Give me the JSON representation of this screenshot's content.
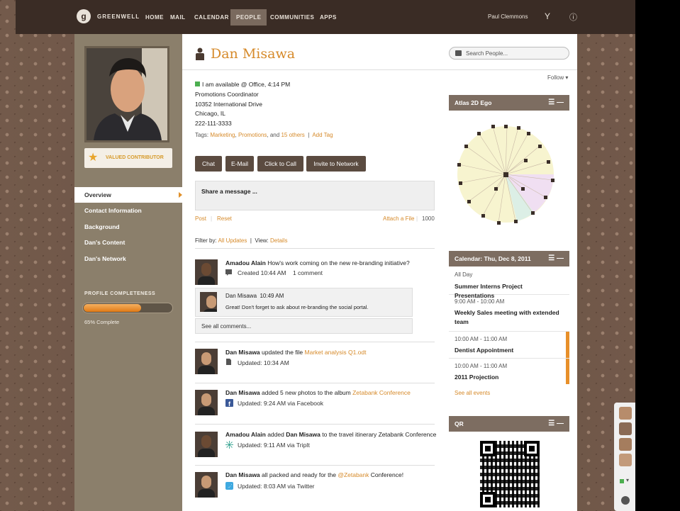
{
  "topbar": {
    "brand": "GREENWELL",
    "nav": [
      "HOME",
      "MAIL",
      "CALENDAR",
      "PEOPLE",
      "COMMUNITIES",
      "APPS"
    ],
    "active_nav": "PEOPLE",
    "user": "Paul Clemmons",
    "icons": [
      "filter-icon",
      "help-icon"
    ]
  },
  "sidebar": {
    "badge": "VALUED CONTRIBUTOR",
    "items": [
      "Overview",
      "Contact Information",
      "Background",
      "Dan's Content",
      "Dan's Network"
    ],
    "active_item": "Overview",
    "profile_completeness_label": "PROFILE COMPLETENESS",
    "profile_completeness_percent": 65,
    "profile_completeness_text": "65% Complete"
  },
  "profile": {
    "name": "Dan Misawa",
    "availability": "I am available @ Office, 4:14 PM",
    "title": "Promotions Coordinator",
    "address1": "10352 International Drive",
    "address2": "Chicago, IL",
    "phone": "222-111-3333",
    "tags_prefix": "Tags:",
    "tag1": "Marketing",
    "tag2": "Promotions",
    "tags_and": "and",
    "tags_others": "15 others",
    "add_tag": "Add Tag",
    "follow": "Follow",
    "search_placeholder": "Search People..."
  },
  "actions": [
    "Chat",
    "E-Mail",
    "Click to Call",
    "Invite to Network"
  ],
  "share": {
    "placeholder": "Share a message ...",
    "post": "Post",
    "reset": "Reset",
    "attach": "Attach a File",
    "count": "1000"
  },
  "filter": {
    "label": "Filter by:",
    "value": "All Updates",
    "view_label": "View:",
    "view_value": "Details"
  },
  "feed": [
    {
      "actor": "Amadou Alain",
      "text": "How's work coming on the new re-branding initiative?",
      "meta": "Created 10:44 AM",
      "extra": "1 comment"
    },
    {
      "actor": "Dan Misawa",
      "text": "updated the file",
      "link": "Market analysis Q1.odt",
      "meta": "Updated: 10:34 AM"
    },
    {
      "actor": "Dan Misawa",
      "text": "added 5 new photos to the album",
      "link": "Zetabank Conference",
      "meta": "Updated: 9:24 AM via Facebook"
    },
    {
      "actor": "Amadou Alain",
      "text": "added",
      "target": "Dan Misawa",
      "text2": "to the travel itinerary Zetabank Conference",
      "meta": "Updated: 9:11 AM via TripIt"
    },
    {
      "actor": "Dan Misawa",
      "text": "all packed and ready for the",
      "link": "@Zetabank",
      "text2": "Conference!",
      "meta": "Updated: 8:03 AM via Twitter"
    }
  ],
  "reply": {
    "actor": "Dan Misawa",
    "time": "10:49 AM",
    "text": "Great! Don't forget to ask about re-branding the social portal."
  },
  "see_all_comments": "See all comments...",
  "panels": {
    "atlas": "Atlas 2D Ego",
    "calendar": "Calendar: Thu, Dec 8, 2011",
    "qr": "QR"
  },
  "calendar": [
    {
      "time": "All Day",
      "title": "Summer Interns Project Presentations"
    },
    {
      "time": "9:00 AM - 10:00 AM",
      "title": "Weekly Sales meeting with extended team"
    },
    {
      "time": "10:00 AM - 11:00 AM",
      "title": "Dentist Appointment"
    },
    {
      "time": "10:00 AM - 11:00 AM",
      "title": "2011 Projection"
    }
  ],
  "see_all_events": "See all events"
}
